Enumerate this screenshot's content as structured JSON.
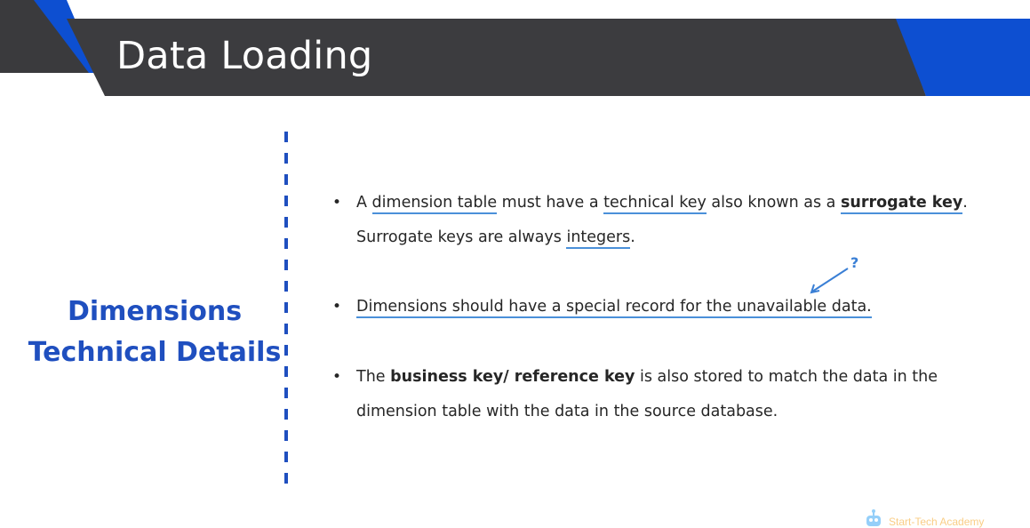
{
  "slide": {
    "title": "Data Loading",
    "section_heading_line1": "Dimensions",
    "section_heading_line2": "Technical Details"
  },
  "bullets": {
    "b1": {
      "p1": "A ",
      "p2": "dimension table",
      "p3": " must have a ",
      "p4": "technical key",
      "p5": " also known as a ",
      "p6": "surrogate key",
      "p7": ".",
      "p8": "Surrogate keys are always ",
      "p9": "integers",
      "p10": "."
    },
    "b2": {
      "p1": "Dimensions should have a special record for the unavailable data."
    },
    "b3": {
      "p1": "The ",
      "p2": "business key/ reference key",
      "p3": " is also stored to match the data in the dimension table with the data in the source database."
    }
  },
  "annotation": {
    "symbol": "?"
  },
  "bullet_symbol": "•",
  "logo": {
    "text": "Start-Tech Academy"
  },
  "colors": {
    "banner_dark": "#3c3c3f",
    "banner_blue": "#0d4fd1",
    "heading_blue": "#1f4fbf",
    "highlight_underline": "#4a90d9",
    "logo_orange": "#f5a623"
  }
}
